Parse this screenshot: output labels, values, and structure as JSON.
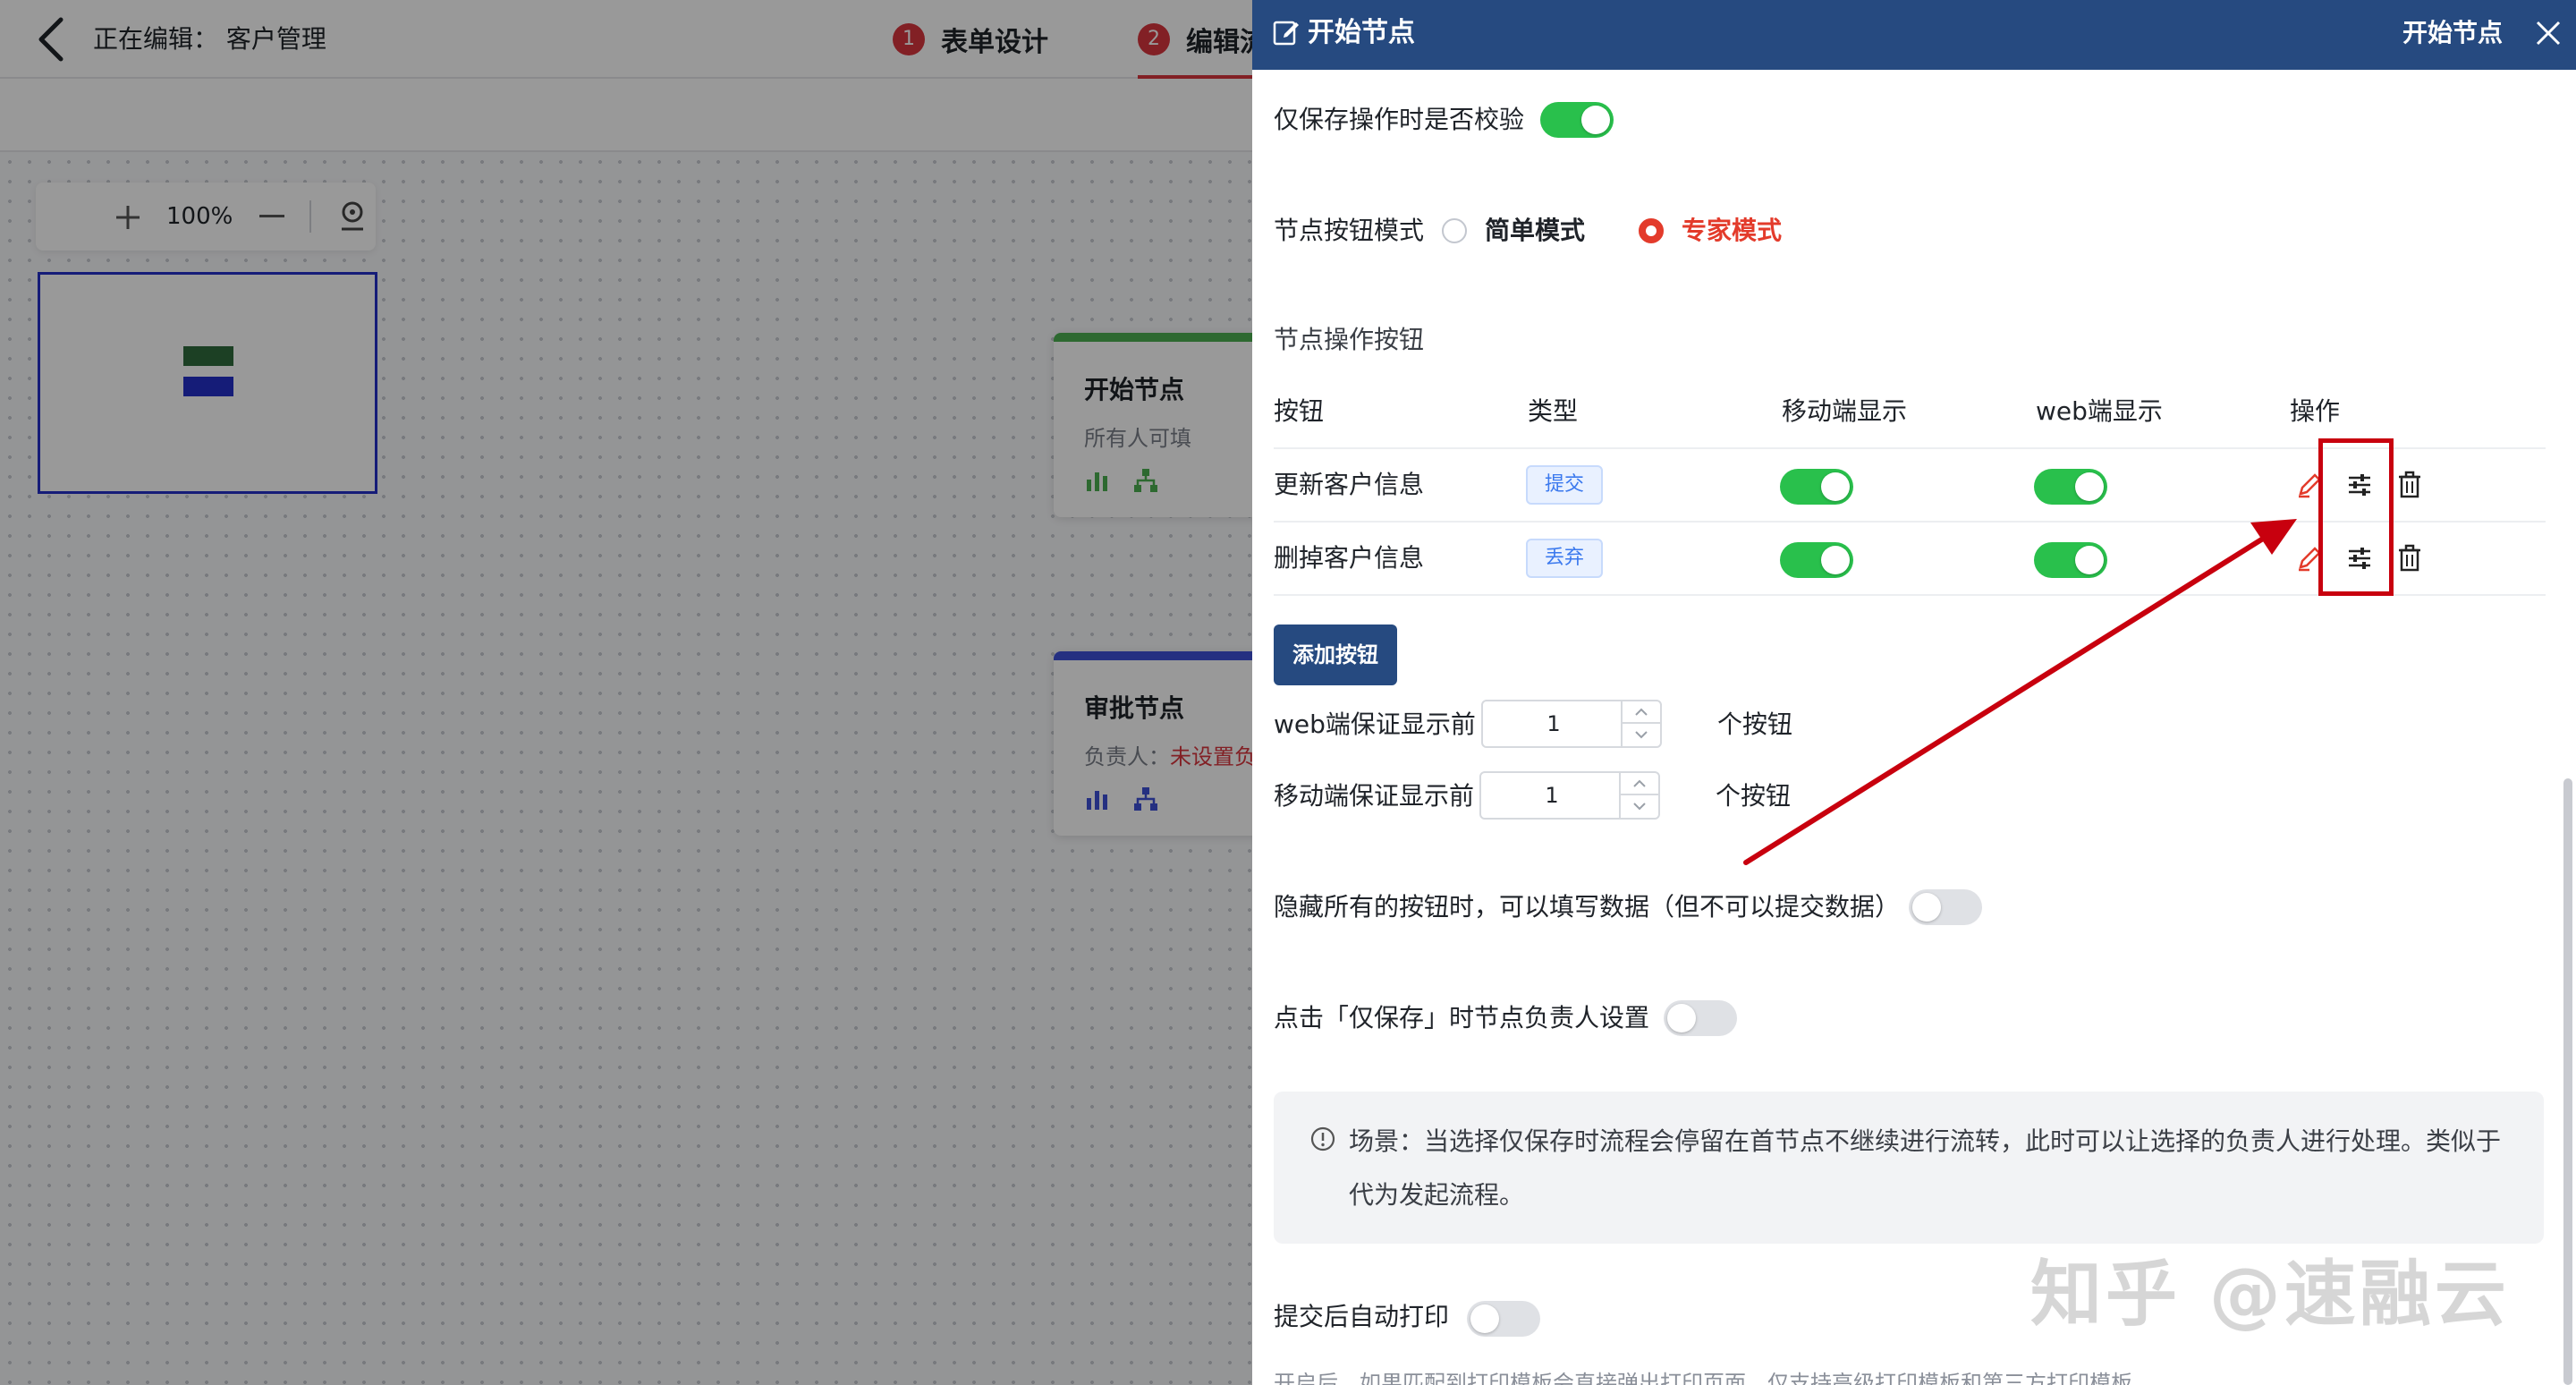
{
  "header": {
    "editing_label": "正在编辑：  客户管理",
    "steps": [
      {
        "num": "1",
        "label": "表单设计"
      },
      {
        "num": "2",
        "label": "编辑流"
      }
    ]
  },
  "canvas": {
    "zoom": "100%",
    "nodes": [
      {
        "title": "开始节点",
        "sub": "所有人可填",
        "color": "#4caf50"
      },
      {
        "title": "审批节点",
        "sub_prefix": "负责人：",
        "sub_warn": "未设置负",
        "color": "#3f51d8"
      }
    ]
  },
  "drawer": {
    "title": "开始节点",
    "title_right": "开始节点",
    "validate_on_save": {
      "label": "仅保存操作时是否校验",
      "on": true
    },
    "button_mode": {
      "label": "节点按钮模式",
      "options": [
        {
          "label": "简单模式",
          "checked": false
        },
        {
          "label": "专家模式",
          "checked": true
        }
      ]
    },
    "section_title": "节点操作按钮",
    "table": {
      "headers": [
        "按钮",
        "类型",
        "移动端显示",
        "web端显示",
        "操作"
      ],
      "rows": [
        {
          "name": "更新客户信息",
          "type": "提交",
          "mobile": true,
          "web": true
        },
        {
          "name": "删掉客户信息",
          "type": "丢弃",
          "mobile": true,
          "web": true
        }
      ]
    },
    "add_button": "添加按钮",
    "web_guarantee": {
      "prefix": "web端保证显示前",
      "value": "1",
      "suffix": "个按钮"
    },
    "mobile_guarantee": {
      "prefix": "移动端保证显示前",
      "value": "1",
      "suffix": "个按钮"
    },
    "hide_all": {
      "label": "隐藏所有的按钮时，可以填写数据（但不可以提交数据）",
      "on": false
    },
    "save_assignee": {
      "label": "点击「仅保存」时节点负责人设置",
      "on": false
    },
    "info": "场景：当选择仅保存时流程会停留在首节点不继续进行流转，此时可以让选择的负责人进行处理。类似于代为发起流程。",
    "auto_print": {
      "label": "提交后自动打印",
      "on": false
    },
    "footer": "开启后，如果匹配到打印模板会直接弹出打印页面，仅支持高级打印模板和第三方打印模板"
  },
  "watermark": "知乎 @速融云",
  "colors": {
    "header_bg": "#264a80",
    "toggle_on": "#29c04c",
    "accent_red": "#e33b2b",
    "annotation_red": "#c8000e"
  },
  "icons": [
    "back-icon",
    "edit-icon",
    "close-icon",
    "pencil-icon",
    "sliders-icon",
    "trash-icon",
    "info-icon",
    "locate-icon",
    "bar-chart-icon",
    "org-chart-icon"
  ]
}
